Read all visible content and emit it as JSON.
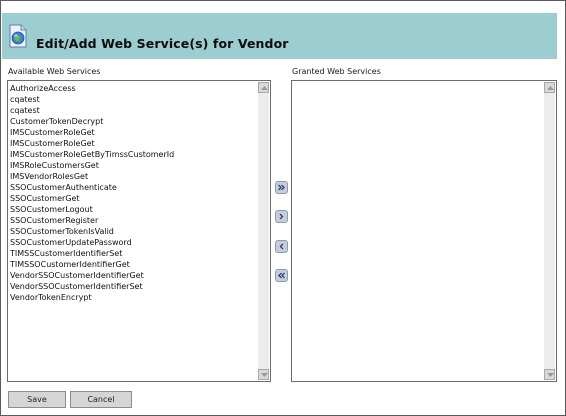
{
  "header": {
    "title": "Edit/Add Web Service(s) for Vendor"
  },
  "available": {
    "label": "Available Web Services",
    "items": [
      "AuthorizeAccess",
      "cqatest",
      "cqatest",
      "CustomerTokenDecrypt",
      "IMSCustomerRoleGet",
      "IMSCustomerRoleGet",
      "IMSCustomerRoleGetByTimssCustomerId",
      "IMSRoleCustomersGet",
      "IMSVendorRolesGet",
      "SSOCustomerAuthenticate",
      "SSOCustomerGet",
      "SSOCustomerLogout",
      "SSOCustomerRegister",
      "SSOCustomerTokenIsValid",
      "SSOCustomerUpdatePassword",
      "TIMSSCustomerIdentifierSet",
      "TIMSSOCustomerIdentifierGet",
      "VendorSSOCustomerIdentifierGet",
      "VendorSSOCustomerIdentifierSet",
      "VendorTokenEncrypt"
    ]
  },
  "granted": {
    "label": "Granted Web Services",
    "items": []
  },
  "buttons": {
    "save": "Save",
    "cancel": "Cancel"
  },
  "colors": {
    "header_bg": "#9ccdd0",
    "move_button": "#c5cdd9"
  }
}
